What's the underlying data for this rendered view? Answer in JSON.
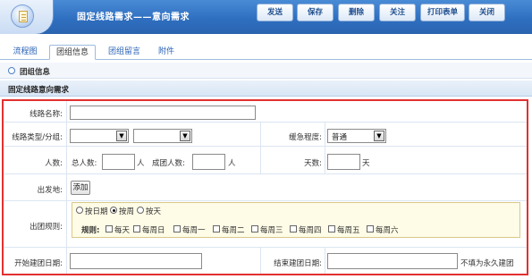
{
  "header": {
    "title": "固定线路需求——意向需求",
    "buttons": [
      "发送",
      "保存",
      "删除",
      "关注",
      "打印表单",
      "关闭"
    ]
  },
  "tabs": [
    "流程图",
    "团组信息",
    "团组留言",
    "附件"
  ],
  "section": {
    "title": "团组信息"
  },
  "subsection": {
    "title": "固定线路意向需求"
  },
  "form": {
    "route_name_label": "线路名称:",
    "route_type_label": "线路类型/分组:",
    "urgency_label": "缓急程度:",
    "urgency_value": "普通",
    "people_label": "人数:",
    "total_label": "总人数:",
    "total_unit": "人",
    "group_label": "成团人数:",
    "group_unit": "人",
    "days_label": "天数:",
    "days_unit": "天",
    "departure_label": "出发地:",
    "add_button": "添加",
    "rule_label": "出团规则:",
    "rule_options": [
      "按日期",
      "按周",
      "按天"
    ],
    "rule_selected": "按周",
    "rule_sub_label": "规则:",
    "weekdays": [
      "每天",
      "每周日",
      "每周一",
      "每周二",
      "每周三",
      "每周四",
      "每周五",
      "每周六"
    ],
    "start_date_label": "开始建团日期:",
    "end_date_label": "结束建团日期:",
    "end_hint": "不填为永久建团"
  },
  "colors": {
    "header_blue": "#2f6fc0",
    "highlight_border": "#e33030"
  }
}
